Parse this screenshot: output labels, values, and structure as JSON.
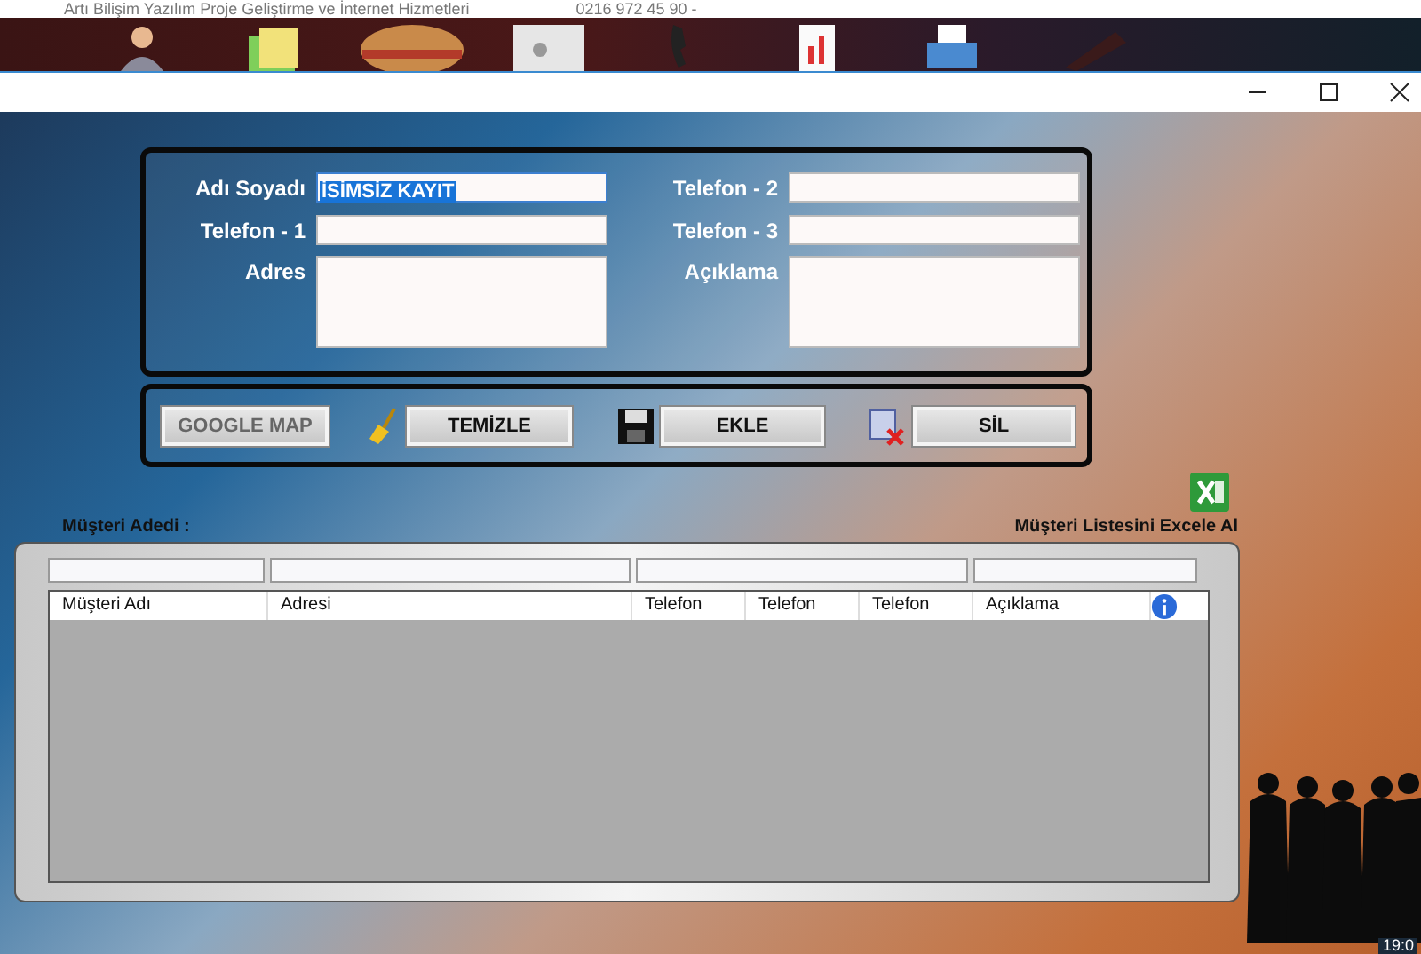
{
  "top_strip": {
    "company": "Artı Bilişim Yazılım Proje Geliştirme ve İnternet Hizmetleri",
    "phone": "0216 972 45 90 -"
  },
  "form": {
    "fields": [
      {
        "label": "Adı Soyadı",
        "value": "İSİMSİZ KAYIT",
        "kind": "line",
        "selected": true
      },
      {
        "label": "Telefon - 2",
        "kind": "line",
        "selected": false
      },
      {
        "label": "Telefon - 1",
        "kind": "line",
        "selected": false
      },
      {
        "label": "Telefon - 3",
        "kind": "line",
        "selected": false
      },
      {
        "label": "Adres",
        "kind": "multiline",
        "selected": false
      },
      {
        "label": "Açıklama",
        "kind": "multiline",
        "selected": false
      }
    ]
  },
  "actions": [
    {
      "label": "GOOGLE MAP",
      "kind": "none",
      "disabled": true
    },
    {
      "label": "TEMİZLE",
      "kind": "broom",
      "disabled": false
    },
    {
      "label": "EKLE",
      "kind": "save",
      "disabled": false
    },
    {
      "label": "SİL",
      "kind": "delete",
      "disabled": false
    }
  ],
  "customer_count_label": "Müşteri Adedi :",
  "excel_export_label": "Müşteri Listesini Excele Al",
  "table": {
    "columns": [
      "Müşteri Adı",
      "Adresi",
      "Telefon",
      "Telefon",
      "Telefon",
      "Açıklama"
    ]
  },
  "clock": "19:0"
}
